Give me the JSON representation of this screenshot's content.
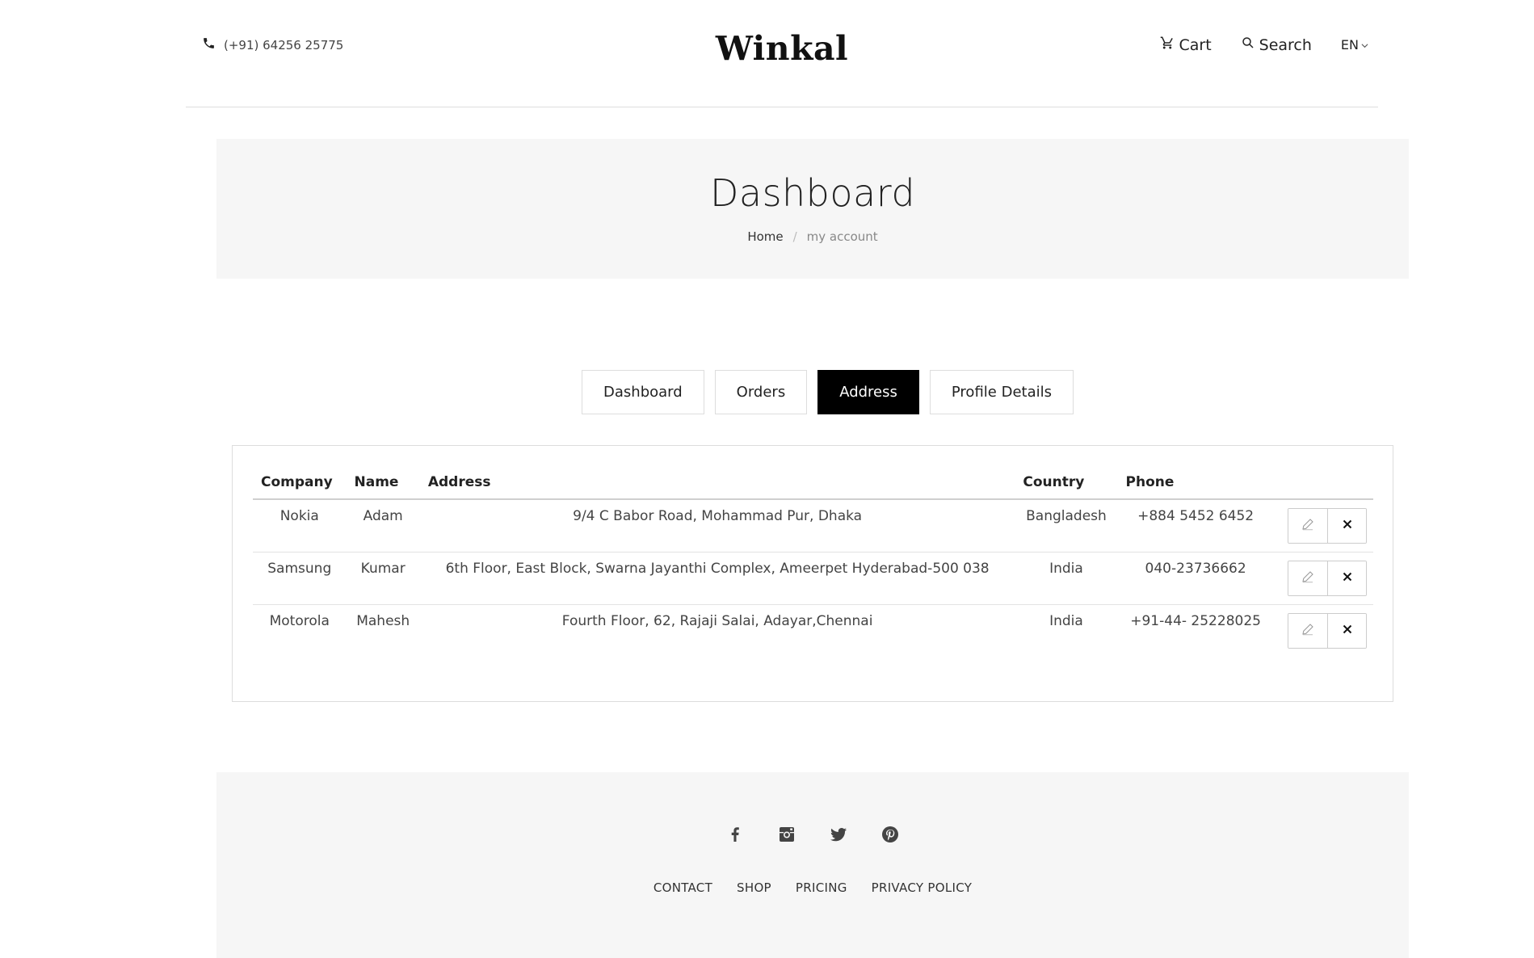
{
  "header": {
    "phone": "(+91) 64256 25775",
    "logo": "Winkal",
    "cart_label": "Cart",
    "search_label": "Search",
    "language": "EN"
  },
  "banner": {
    "title": "Dashboard",
    "breadcrumb_home": "Home",
    "breadcrumb_sep": "/",
    "breadcrumb_current": "my account"
  },
  "tabs": [
    {
      "label": "Dashboard",
      "active": false
    },
    {
      "label": "Orders",
      "active": false
    },
    {
      "label": "Address",
      "active": true
    },
    {
      "label": "Profile Details",
      "active": false
    }
  ],
  "address_table": {
    "headers": [
      "Company",
      "Name",
      "Address",
      "Country",
      "Phone",
      ""
    ],
    "rows": [
      {
        "company": "Nokia",
        "name": "Adam",
        "address": "9/4 C Babor Road, Mohammad Pur, Dhaka",
        "country": "Bangladesh",
        "phone": "+884 5452 6452"
      },
      {
        "company": "Samsung",
        "name": "Kumar",
        "address": "6th Floor, East Block, Swarna Jayanthi Complex, Ameerpet Hyderabad-500 038",
        "country": "India",
        "phone": "040-23736662"
      },
      {
        "company": "Motorola",
        "name": "Mahesh",
        "address": "Fourth Floor, 62, Rajaji Salai, Adayar,Chennai",
        "country": "India",
        "phone": "+91-44- 25228025"
      }
    ]
  },
  "footer": {
    "social": [
      "facebook-icon",
      "instagram-icon",
      "twitter-icon",
      "pinterest-icon"
    ],
    "links": [
      "CONTACT",
      "SHOP",
      "PRICING",
      "PRIVACY POLICY"
    ]
  },
  "colors": {
    "banner_bg": "#f6f6f6",
    "active_tab_bg": "#000000",
    "text": "#333333"
  }
}
